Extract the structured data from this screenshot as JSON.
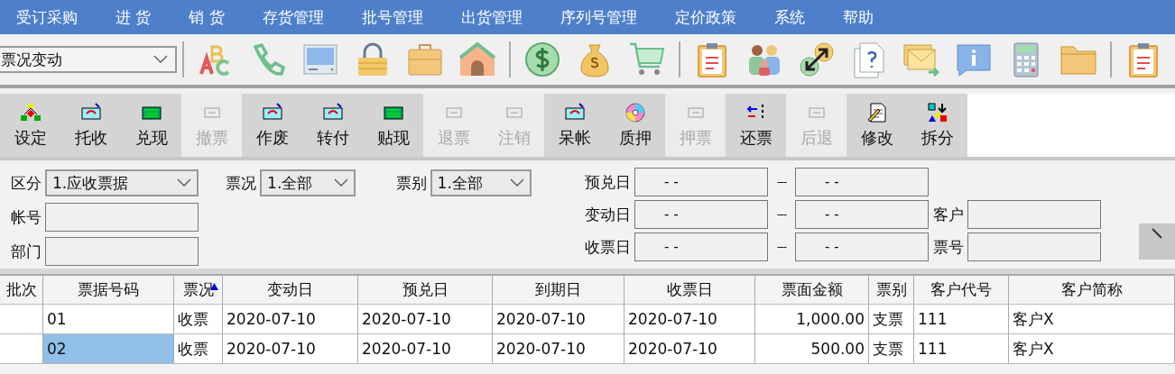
{
  "menu": [
    "受订采购",
    "进 货",
    "销 货",
    "存货管理",
    "批号管理",
    "出货管理",
    "序列号管理",
    "定价政策",
    "系统",
    "帮助"
  ],
  "toolbar": {
    "view_select": "票况变动"
  },
  "actions": [
    {
      "label": "设定",
      "disabled": false
    },
    {
      "label": "托收",
      "disabled": false
    },
    {
      "label": "兑现",
      "disabled": false
    },
    {
      "label": "撤票",
      "disabled": true
    },
    {
      "label": "作废",
      "disabled": false
    },
    {
      "label": "转付",
      "disabled": false
    },
    {
      "label": "贴现",
      "disabled": false
    },
    {
      "label": "退票",
      "disabled": true
    },
    {
      "label": "注销",
      "disabled": true
    },
    {
      "label": "呆帐",
      "disabled": false
    },
    {
      "label": "质押",
      "disabled": false
    },
    {
      "label": "押票",
      "disabled": true
    },
    {
      "label": "还票",
      "disabled": false
    },
    {
      "label": "后退",
      "disabled": true
    },
    {
      "label": "修改",
      "disabled": false
    },
    {
      "label": "拆分",
      "disabled": false
    }
  ],
  "filters": {
    "category": {
      "label": "区分",
      "value": "1.应收票据"
    },
    "account": {
      "label": "帐号"
    },
    "department": {
      "label": "部门"
    },
    "status": {
      "label": "票况",
      "value": "1.全部"
    },
    "bill_type": {
      "label": "票别",
      "value": "1.全部"
    },
    "date_ranges": [
      {
        "label": "预兑日",
        "from": "- -",
        "separator": "---",
        "to": "- -"
      },
      {
        "label": "变动日",
        "from": "- -",
        "separator": "---",
        "to": "- -"
      },
      {
        "label": "收票日",
        "from": "- -",
        "separator": "---",
        "to": "- -"
      }
    ],
    "customer": {
      "label": "客户"
    },
    "bill_no": {
      "label": "票号"
    }
  },
  "table": {
    "columns": [
      "批次",
      "票据号码",
      "票况",
      "变动日",
      "预兑日",
      "到期日",
      "收票日",
      "票面金额",
      "票别",
      "客户代号",
      "客户简称"
    ],
    "rows": [
      {
        "selected": false,
        "cells": [
          "",
          "01",
          "收票",
          "2020-07-10",
          "2020-07-10",
          "2020-07-10",
          "2020-07-10",
          "1,000.00",
          "支票",
          "111",
          "客户X"
        ]
      },
      {
        "selected": true,
        "cells": [
          "",
          "02",
          "收票",
          "2020-07-10",
          "2020-07-10",
          "2020-07-10",
          "2020-07-10",
          "500.00",
          "支票",
          "111",
          "客户X"
        ]
      }
    ]
  }
}
